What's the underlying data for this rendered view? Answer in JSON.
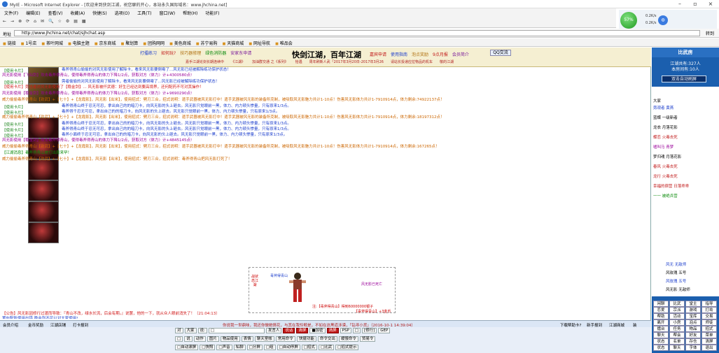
{
  "window": {
    "title": "MyIE - Microsoft Internet Explorer - [欢迎来到侠剑江湖，祝您聊的开心，本站永久国际域名：www.jhchina.net]"
  },
  "menu": [
    "文件(F)",
    "编辑(E)",
    "查看(V)",
    "收藏(A)",
    "快捷(S)",
    "选项(O)",
    "工具(T)",
    "窗口(W)",
    "帮助(H)",
    "功能(F)"
  ],
  "toolbar": [
    "←",
    "→",
    "⊗",
    "⟳",
    "⌂",
    "✉",
    "🔍",
    "☆",
    "⚙",
    "▤",
    "▦"
  ],
  "net": {
    "percent": "57%",
    "up": "0.2K/s",
    "down": "0.2K/s"
  },
  "address": {
    "label": "地址",
    "url": "http://www.jhchina.net/chat/sjhchat.asp",
    "go": "转到"
  },
  "links": [
    "链接",
    "1号店",
    "茶叶网城",
    "电脑主题",
    "京东商城",
    "聚划算",
    "团购网网",
    "美色商城",
    "苏宁易购",
    "天猫商城",
    "网址导航",
    "唯品会"
  ],
  "banner": {
    "left": [
      "打擂练习",
      "如何玩?",
      "技巧器修理",
      "绿色消防器",
      "安家东申请"
    ],
    "title": "快剑江湖，百年江湖",
    "right": [
      "嘉宾申请",
      "使用指南",
      "泡点奖励",
      "9点月报",
      "会员简介"
    ],
    "qq": "QQ交流",
    "news": [
      "嘉手江湖论剑长期连续中",
      "《江湖》",
      "加油群交通 之《系列》",
      "恰遇",
      "周年刷新人武「2017年3月20日-2017年3月26",
      "请站长投递应拉物品的机车",
      "敬的江湖"
    ]
  },
  "chat": [
    {
      "cls": "g",
      "text": "【使用卡片】"
    },
    {
      "cls": "b",
      "text": "毒斧得青山偷偷的对风无影使用了解除卡，看来风无影要倒霉了...风无影已经被解除练功保护状态！"
    },
    {
      "cls": "p",
      "text": "风无影使用【飞仙剑】攻击毒斧得青山，使得毒斧得青山的体力下降1/2点，获取对方〈体力〉计+4300580点!"
    },
    {
      "cls": "g",
      "text": "【使用卡片】"
    },
    {
      "cls": "b",
      "text": "旁者偷偷的对风无影使用了解除卡，看来风无影要倒霉了...风无影已经被解除练功保护状态！"
    },
    {
      "cls": "r",
      "text": "【使用卡片】旁当者对风无影使用了【稳金剑】... 风无影被仟武德：好生已经达到要高境界，还何配药不可对其操作！"
    },
    {
      "cls": "p",
      "text": "风无影使用【稳金剑】攻击毒斧得青山，使得毒斧得青山的体力下降1/2点，获取对方〈体力〉计+9690290点!"
    },
    {
      "cls": "o",
      "text": "威力偷偷毒斧得青山【劲武】+【七十】+【龙霞影】，风无影【出米】，使用招式：劈刃三合，招式说明：遣手武器被风无影打中！遣手武器被风无影的装备所克制，被吸取风无影魅力共计1-10点！伤害风无影体力共计1-7910914点，体力剩余:74922137点！"
    },
    {
      "cls": "g",
      "text": "【使用卡片】"
    },
    {
      "cls": "b",
      "text": "毒斧得青山终于忍无可忍，拿出自己的的暗刀卡，向风无影的头上砸去。风无影只觉眼前一黑，体力、内力顿头惨量，只有原来1/3点。"
    },
    {
      "cls": "g",
      "text": "【使用卡片】"
    },
    {
      "cls": "b",
      "text": "毒斧得千忍无可忍，拿出自己的的暗刀卡，向风无影的头上砸去。风无影只觉眼前一黑，体力、内力顿头惨量，只有原来1/3点。"
    },
    {
      "cls": "o",
      "text": "威力偷偷毒斧得青山【劲武】+【七十】+【龙霞影】，风无影【出米】，使用招式：劈刃三合，招式说明：遣手武器被风无影打中！遣手武器被风无影的装备所克制，被吸取风无影魅力共计1-10点！伤害风无影体力共计1-7910914点，体力剩余:18197312点！"
    },
    {
      "cls": "g",
      "text": "【使用卡片】"
    },
    {
      "cls": "b",
      "text": "毒斧得青山终于忍无可忍，拿出自己的的暗刀卡，向风无影的头上砸去。风无影只觉眼前一黑，体力、内力顿头惨量，只有原来1/3点。"
    },
    {
      "cls": "g",
      "text": "【使用卡片】"
    },
    {
      "cls": "b",
      "text": "毒斧得青山终于忍无可忍，拿出自己的的暗刀卡，向风无影的头上砸去。风无影只觉眼前一黑，体力、内力顿头惨量，只有原来1/3点。"
    },
    {
      "cls": "g",
      "text": "【使用卡片】"
    },
    {
      "cls": "b",
      "text": "毒斧小面终于忍无可忍，拿出自己的的暗刀卡，向风无影的头上砸去。风无影只觉眼前一黑，体力、内力顿头惨量，只有原来1/3点。"
    },
    {
      "cls": "p",
      "text": "风无影使用【稳金剑】攻击毒斧得青山，使得毒斧得青山的体力下降1/2点，获取对方〈体力〉计+4845145点!"
    },
    {
      "cls": "o",
      "text": "威力偷偷毒斧得青山【劲武】+【七十】+【龙霞影】，风无影【出米】，使用招式：劈刃三合，招式说明：遣手武器被风无影打中！遣手武器被风无影的装备所克制，被吸取风无影魅力共计1-10点！伤害风无影体力共计1-7910914点，体力剩余:167265点！"
    },
    {
      "cls": "m",
      "text": "【江湖消息】毒斧得青山被打出局来罕！"
    },
    {
      "cls": "o",
      "text": "威力偷偷毒斧得青山【劲武】+【七十】+【龙霞影】，风无影【出米】，使用招式：劈刃三合，招式说明：毒斧得青山把风无影打死了！"
    }
  ],
  "fight": {
    "tag1": "毒斧得青山",
    "tag2": "风无影已死亡",
    "status": "战状态江湖",
    "result": "注:【毒斧得青山】得到60000000银子",
    "result2": "【毒斧得青山】+3金币"
  },
  "notices": [
    {
      "cls": "r",
      "text": "【公告】风无影因修行过渡而导致：『青山不改，绿水长流，后会有期。』说罢，他的一下，就从众人眼前消失了！（21:04:13）"
    },
    {
      "cls": "b",
      "text": "置包配所使用出错 稳金剑不可以对大家使用!"
    },
    {
      "cls": "g",
      "text": "【公告】猴气儿骑抓击\"梦遗偷步\"，钻神阔兵【会员宣传】来到了【比武房】（21:04:25）"
    }
  ],
  "bottom": {
    "left": [
      "会员介绍",
      "金币奖励",
      "江湖店铺",
      "打卡报到"
    ],
    "mid": "你说我一世鼎味，我还你做她情花，与其在我怜鲸是，不如在这黑道涉漠，「钻寻小货」（2016-10-1 14:39:04）",
    "right": [
      "下载帮助卡?",
      "新手报到",
      "江湖商城",
      "装"
    ]
  },
  "input": {
    "row1": [
      "对",
      "大家",
      "说:",
      "□",
      "发言人",
      "说话",
      "清屏",
      "■加密",
      "清屏",
      "PSP",
      "□",
      "[修行]",
      "GEP"
    ],
    "row2": [
      "□",
      "说",
      "动作",
      "图片",
      "物品使用",
      "表情",
      "聊天室帐",
      "常用命令",
      "快捷功能",
      "命令交出",
      "缓慢命令",
      "贸易令"
    ],
    "row3": [
      "□自动滚屏",
      "□快照",
      "□声音",
      "私聊",
      "□分屏",
      "□组",
      "□自动停屏",
      "□招式",
      "□比武",
      "□招式提示"
    ]
  },
  "side": {
    "title": "比武房",
    "total": "江湖共有:327人",
    "room": "本房间有:10人",
    "auto": "双击自动刷屏",
    "everyone": "大家",
    "users": [
      "旁观者 黄燕",
      "蓝蝶 一级新者",
      "龙衣 月落花影",
      "蝶恋 火毒去死",
      "嘘叫马 青梦",
      "梦归魂 月落花影",
      "春风 火毒去死",
      "龙行 火毒去死",
      "幸福的宿营 日落乖乖",
      "一一 被绝兵营"
    ],
    "bottomusers": [
      "风无 无敌师",
      "风玫瑰 五号",
      "风玫瑰 五号",
      "风无影 无敌师"
    ],
    "grid": [
      "闲聊",
      "比武",
      "堂主",
      "指导",
      "恋爱",
      "宗派",
      "游戏",
      "打劫",
      "帮助",
      "活动",
      "宝库",
      "交易",
      "离开",
      "小房",
      "泡点",
      "师徒",
      "擂台",
      "任务",
      "物品",
      "招式",
      "聊天",
      "帮会",
      "好友",
      "菜单",
      "状态",
      "名单",
      "存仓",
      "清屏",
      "状态",
      "聊天",
      "字体",
      "退出"
    ]
  },
  "colors": {
    "sidebar": "#1b5fae",
    "banner": "#f5efd2",
    "accent": "#d01818"
  }
}
